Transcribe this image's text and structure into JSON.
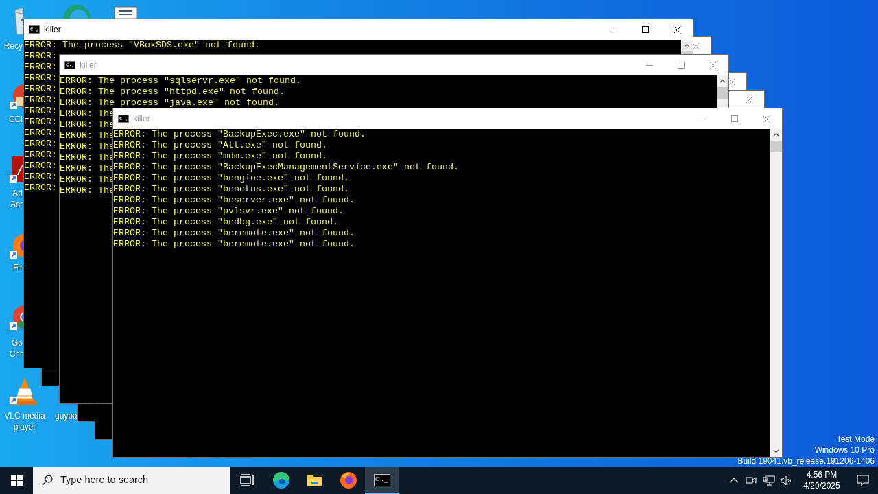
{
  "desktop_icons": [
    {
      "kind": "recycle-bin",
      "lines": [
        "Recy"
      ]
    },
    {
      "kind": "edge"
    },
    {
      "kind": "document"
    },
    {
      "kind": "ccleaner",
      "lines": [
        "CCl"
      ]
    },
    {
      "kind": "acrobat",
      "lines": [
        "Ad",
        "Acr"
      ]
    },
    {
      "kind": "firefox",
      "lines": [
        "Fir"
      ]
    },
    {
      "kind": "chrome",
      "lines": [
        "Go",
        "Chr"
      ]
    },
    {
      "kind": "vlc",
      "lines": [
        "VLC media",
        "player"
      ]
    },
    {
      "kind": "file",
      "lines": [
        "guypa"
      ]
    }
  ],
  "windows": [
    {
      "kind": "background"
    },
    {
      "kind": "console",
      "title": "killer",
      "active": true,
      "lines": [
        "ERROR: The process \"VBoxSDS.exe\" not found.",
        "ERROR:",
        "ERROR:",
        "ERROR:",
        "ERROR:",
        "ERROR:",
        "ERROR:",
        "ERROR:",
        "ERROR:",
        "ERROR:",
        "ERROR:",
        "ERROR:",
        "ERROR:",
        "ERROR:"
      ]
    },
    {
      "kind": "background"
    },
    {
      "kind": "background"
    },
    {
      "kind": "console",
      "title": "killer",
      "active": false,
      "lines": [
        "ERROR: The process \"sqlservr.exe\" not found.",
        "ERROR: The process \"httpd.exe\" not found.",
        "ERROR: The process \"java.exe\" not found.",
        "ERROR: The",
        "ERROR: The",
        "ERROR: The",
        "ERROR: The",
        "ERROR: The",
        "ERROR: The",
        "ERROR: The",
        "ERROR: The"
      ]
    },
    {
      "kind": "console",
      "title": "killer",
      "active": false,
      "lines": [
        "ERROR: The process \"BackupExec.exe\" not found.",
        "ERROR: The process \"Att.exe\" not found.",
        "ERROR: The process \"mdm.exe\" not found.",
        "ERROR: The process \"BackupExecManagementService.exe\" not found.",
        "ERROR: The process \"bengine.exe\" not found.",
        "ERROR: The process \"benetns.exe\" not found.",
        "ERROR: The process \"beserver.exe\" not found.",
        "ERROR: The process \"pvlsvr.exe\" not found.",
        "ERROR: The process \"bedbg.exe\" not found.",
        "ERROR: The process \"beremote.exe\" not found.",
        "ERROR: The process \"beremote.exe\" not found."
      ]
    }
  ],
  "os_notice": [
    "Test Mode",
    "Windows 10 Pro",
    "Build 19041.vb_release.191206-1406"
  ],
  "taskbar": {
    "search": {
      "placeholder": "Type here to search"
    },
    "apps": [
      {
        "kind": "task-view",
        "selected": false
      },
      {
        "kind": "edge",
        "selected": false
      },
      {
        "kind": "explorer",
        "selected": false
      },
      {
        "kind": "firefox",
        "selected": false
      },
      {
        "kind": "console",
        "selected": true
      }
    ],
    "clock": {
      "time": "4:56 PM",
      "date": "4/29/2025"
    }
  }
}
